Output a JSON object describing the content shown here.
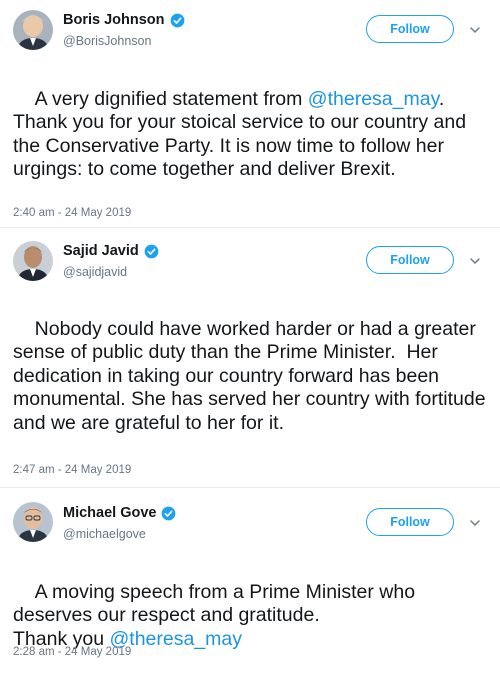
{
  "tweets": [
    {
      "author_name": "Boris Johnson",
      "handle": "@BorisJohnson",
      "follow_label": "Follow",
      "body_parts": [
        {
          "text": "A very dignified statement from ",
          "mention": false
        },
        {
          "text": "@theresa_may",
          "mention": true
        },
        {
          "text": ". Thank you for your stoical service to our country and the Conservative Party. It is now time to follow her urgings: to come together and deliver Brexit.",
          "mention": false
        }
      ],
      "timestamp": "2:40 am - 24 May 2019"
    },
    {
      "author_name": "Sajid Javid",
      "handle": "@sajidjavid",
      "follow_label": "Follow",
      "body_parts": [
        {
          "text": "Nobody could have worked harder or had a greater sense of public duty than the Prime Minister.  Her dedication in taking our country forward has been monumental. She has served her country with fortitude and we are grateful to her for it.",
          "mention": false
        }
      ],
      "timestamp": "2:47 am - 24 May 2019"
    },
    {
      "author_name": "Michael Gove",
      "handle": "@michaelgove",
      "follow_label": "Follow",
      "body_parts": [
        {
          "text": "A moving speech from a Prime Minister who deserves our respect and gratitude.\nThank you ",
          "mention": false
        },
        {
          "text": "@theresa_may",
          "mention": true
        }
      ],
      "timestamp": "2:28 am - 24 May 2019"
    }
  ],
  "colors": {
    "accent": "#1da1f2",
    "mention": "#1b95e0",
    "secondary_text": "#657786",
    "verified": "#1da1f2"
  },
  "icons": {
    "verified": "verified-badge-icon",
    "caret": "chevron-down-icon",
    "avatar": "profile-photo"
  }
}
